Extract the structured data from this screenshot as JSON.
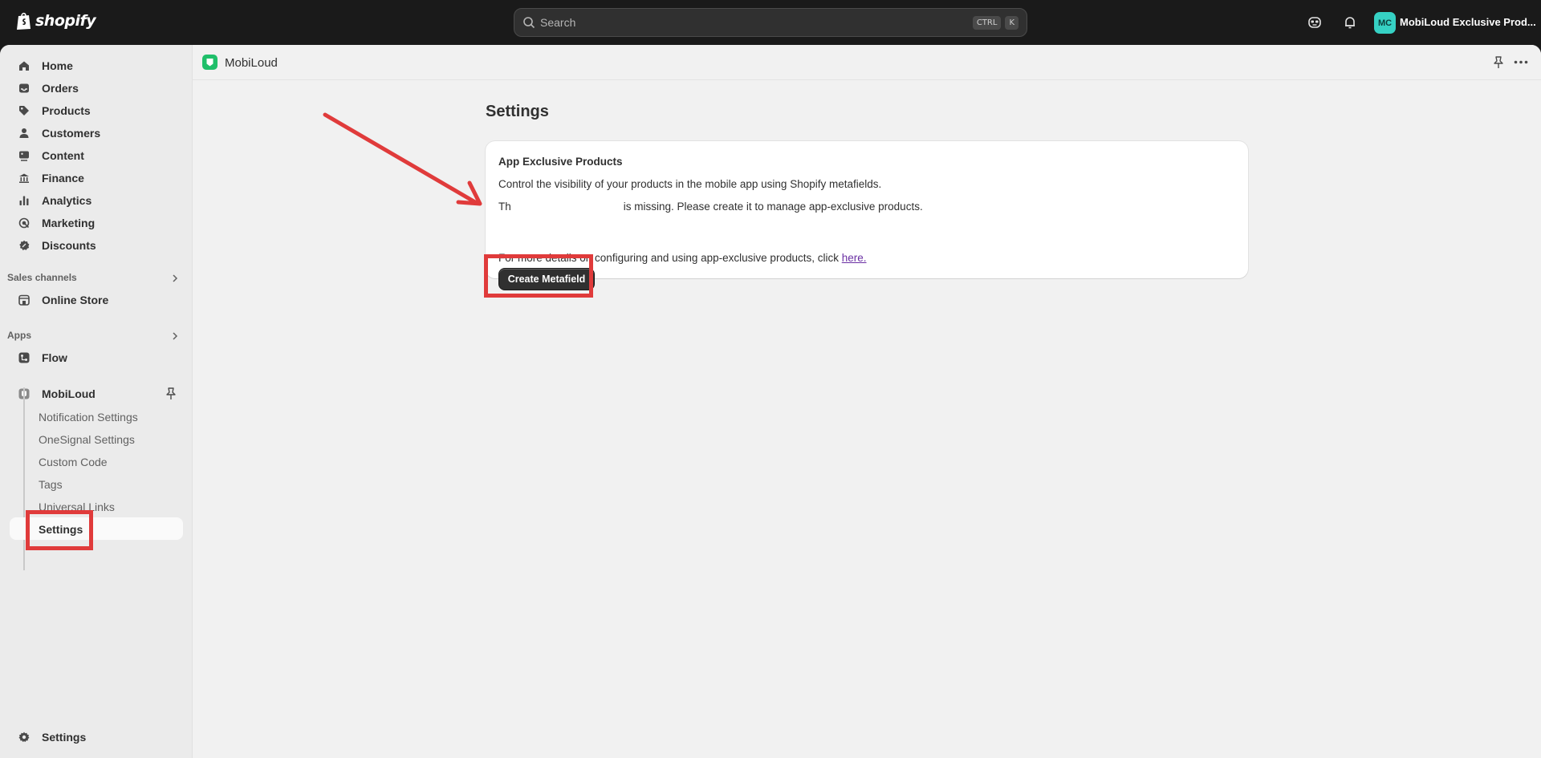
{
  "topbar": {
    "brand": "shopify",
    "search_placeholder": "Search",
    "shortcut_keys": [
      "CTRL",
      "K"
    ],
    "avatar_initials": "MC",
    "store_name": "MobiLoud Exclusive Prod..."
  },
  "sidebar": {
    "items": [
      {
        "label": "Home",
        "icon": "home-icon"
      },
      {
        "label": "Orders",
        "icon": "inbox-icon"
      },
      {
        "label": "Products",
        "icon": "tag-icon"
      },
      {
        "label": "Customers",
        "icon": "person-icon"
      },
      {
        "label": "Content",
        "icon": "image-icon"
      },
      {
        "label": "Finance",
        "icon": "bank-icon"
      },
      {
        "label": "Analytics",
        "icon": "bar-chart-icon"
      },
      {
        "label": "Marketing",
        "icon": "target-icon"
      },
      {
        "label": "Discounts",
        "icon": "discount-icon"
      }
    ],
    "sales_channels_label": "Sales channels",
    "online_store_label": "Online Store",
    "apps_label": "Apps",
    "flow_label": "Flow",
    "app_label": "MobiLoud",
    "app_subitems": [
      "Notification Settings",
      "OneSignal Settings",
      "Custom Code",
      "Tags",
      "Universal Links"
    ],
    "active_subitem": "Settings",
    "bottom_settings_label": "Settings"
  },
  "appbar": {
    "app_name": "MobiLoud"
  },
  "main": {
    "page_title": "Settings",
    "card": {
      "title": "App Exclusive Products",
      "description": "Control the visibility of your products in the mobile app using Shopify metafields.",
      "warning_prefix": "Th",
      "warning_rest": "is missing. Please create it to manage app-exclusive products.",
      "button_label": "Create Metafield",
      "footer_prefix": "For more details on configuring and using app-exclusive products, click",
      "footer_link": "here."
    }
  },
  "colors": {
    "topbar": "#1a1a1a",
    "sidebar": "#ebebeb",
    "main_bg": "#f1f1f1",
    "button": "#303030",
    "annotation": "#e03b3b",
    "link": "#6a2fa3",
    "avatar": "#36d1c4",
    "app_logo": "#1fbf6a"
  }
}
